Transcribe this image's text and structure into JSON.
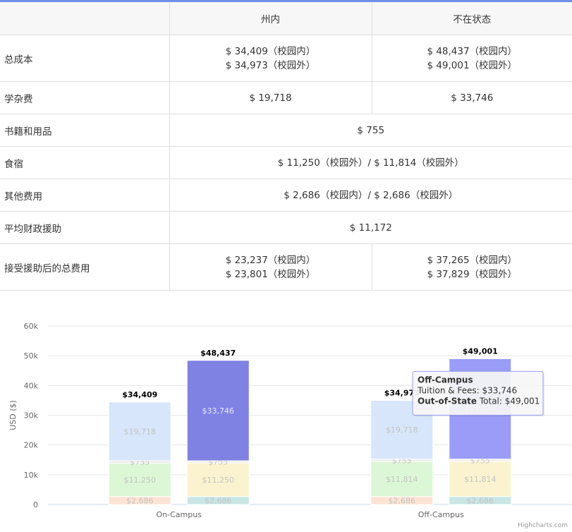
{
  "table": {
    "headers": [
      "",
      "州内",
      "不在状态"
    ],
    "rows": [
      {
        "label": "总成本",
        "in_state": [
          "$ 34,409（校园内）",
          "$ 34,973（校园外）"
        ],
        "out_state": [
          "$ 48,437（校园内）",
          "$ 49,001（校园外）"
        ]
      },
      {
        "label": "学杂费",
        "in_state": [
          "$ 19,718"
        ],
        "out_state": [
          "$ 33,746"
        ]
      },
      {
        "label": "书籍和用品",
        "shared": "$ 755"
      },
      {
        "label": "食宿",
        "shared": "$ 11,250（校园外）/ $ 11,814（校园外）"
      },
      {
        "label": "其他费用",
        "shared": "$ 2,686（校园内）/ $ 2,686（校园外）"
      },
      {
        "label": "平均财政援助",
        "shared": "$ 11,172"
      },
      {
        "label": "接受援助后的总费用",
        "in_state": [
          "$ 23,237（校园内）",
          "$ 23,801（校园外）"
        ],
        "out_state": [
          "$ 37,265（校园内）",
          "$ 37,829（校园外）"
        ]
      }
    ]
  },
  "chart_data": {
    "type": "bar",
    "stacked": true,
    "categories": [
      "On-Campus",
      "Off-Campus"
    ],
    "ylabel": "USD ($)",
    "ylim": [
      0,
      60000
    ],
    "yticks": [
      0,
      10000,
      20000,
      30000,
      40000,
      50000,
      60000
    ],
    "ytick_labels": [
      "0",
      "10k",
      "20k",
      "30k",
      "40k",
      "50k",
      "60k"
    ],
    "grid": true,
    "stacks": [
      {
        "stack": "In-State",
        "totals": [
          34409,
          34973
        ],
        "total_labels": [
          "$34,409",
          "$34,973"
        ],
        "segments": [
          {
            "name": "Other",
            "values": [
              2686,
              2686
            ],
            "labels": [
              "$2,686",
              "$2,686"
            ],
            "color": "#fde3d4"
          },
          {
            "name": "Room & Board",
            "values": [
              11250,
              11814
            ],
            "labels": [
              "$11,250",
              "$11,814"
            ],
            "color": "#dcf7d6"
          },
          {
            "name": "Books & Supplies",
            "values": [
              755,
              755
            ],
            "labels": [
              "$755",
              "$755"
            ],
            "color": "#ececec"
          },
          {
            "name": "Tuition & Fees",
            "values": [
              19718,
              19718
            ],
            "labels": [
              "$19,718",
              "$19,718"
            ],
            "color": "#d7e6fa"
          }
        ]
      },
      {
        "stack": "Out-of-State",
        "totals": [
          48437,
          49001
        ],
        "total_labels": [
          "$48,437",
          "$49,001"
        ],
        "segments": [
          {
            "name": "Other",
            "values": [
              2686,
              2686
            ],
            "labels": [
              "$2,686",
              "$2,686"
            ],
            "color": "#c8e6e4"
          },
          {
            "name": "Room & Board",
            "values": [
              11250,
              11814
            ],
            "labels": [
              "$11,250",
              "$11,814"
            ],
            "color": "#fbf3cf"
          },
          {
            "name": "Books & Supplies",
            "values": [
              755,
              755
            ],
            "labels": [
              "$755",
              "$755"
            ],
            "color": "#f1efe6"
          },
          {
            "name": "Tuition & Fees",
            "values": [
              33746,
              33746
            ],
            "labels": [
              "$33,746",
              "$33,746"
            ],
            "colors": [
              "#7f82e3",
              "#9a9cf7"
            ]
          }
        ]
      }
    ],
    "tooltip": {
      "title": "Off-Campus",
      "line1": "Tuition & Fees: $33,746",
      "line2_bold": "Out-of-State",
      "line2_rest": " Total: $49,001"
    },
    "credits": "Highcharts.com"
  }
}
